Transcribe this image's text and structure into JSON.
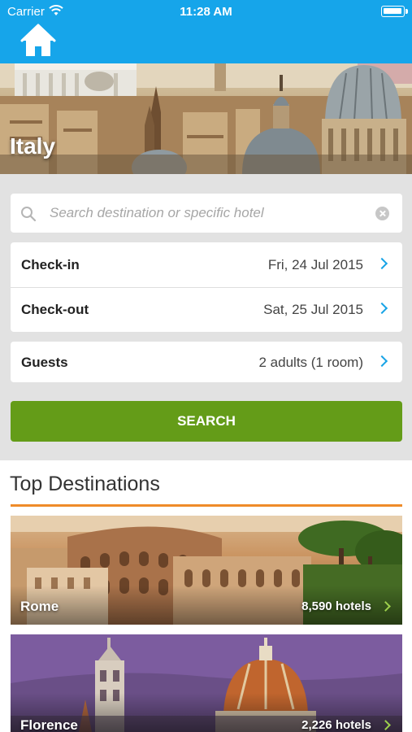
{
  "status_bar": {
    "carrier": "Carrier",
    "time": "11:28 AM",
    "icons": [
      "wifi-icon",
      "battery-icon"
    ]
  },
  "nav": {
    "home_icon": "home-icon",
    "bar_color": "#16a5ea"
  },
  "hero": {
    "title": "Italy"
  },
  "search": {
    "placeholder": "Search destination or specific hotel",
    "value": "",
    "icon": "search-icon",
    "clear_icon": "clear-icon"
  },
  "booking": {
    "checkin_label": "Check-in",
    "checkin_value": "Fri, 24 Jul 2015",
    "checkout_label": "Check-out",
    "checkout_value": "Sat, 25 Jul 2015",
    "guests_label": "Guests",
    "guests_value": "2 adults (1 room)",
    "chevron_color": "#17a3e6"
  },
  "search_button": {
    "label": "SEARCH",
    "color": "#649c18"
  },
  "destinations": {
    "heading": "Top Destinations",
    "accent_color": "#ef8b29",
    "items": [
      {
        "name": "Rome",
        "hotels": "8,590 hotels"
      },
      {
        "name": "Florence",
        "hotels": "2,226 hotels"
      }
    ]
  }
}
